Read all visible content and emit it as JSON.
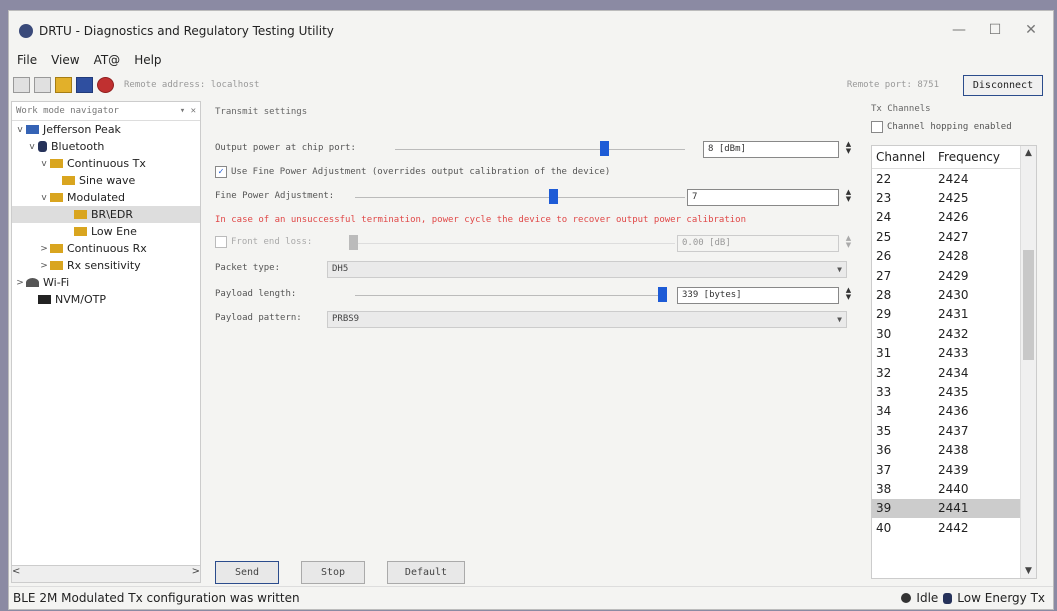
{
  "window": {
    "title": "DRTU - Diagnostics and Regulatory Testing Utility",
    "minimize": "—",
    "maximize": "☐",
    "close": "✕"
  },
  "menu": [
    "File",
    "View",
    "AT@",
    "Help"
  ],
  "toolbar": {
    "remote_address": "Remote address: localhost",
    "remote_port": "Remote port: 8751",
    "disconnect": "Disconnect"
  },
  "nav": {
    "header": "Work mode navigator",
    "pin": "▾ ✕",
    "items": [
      {
        "label": "Jefferson Peak",
        "chev": "v",
        "icon": "person",
        "indent": 0
      },
      {
        "label": "Bluetooth",
        "chev": "v",
        "icon": "bt",
        "indent": 1
      },
      {
        "label": "Continuous Tx",
        "chev": "v",
        "icon": "folder",
        "indent": 2
      },
      {
        "label": "Sine wave",
        "chev": "",
        "icon": "folder",
        "indent": 3
      },
      {
        "label": "Modulated",
        "chev": "v",
        "icon": "folder",
        "indent": 2
      },
      {
        "label": "BR\\EDR",
        "chev": "",
        "icon": "folder",
        "indent": 4,
        "selected": true
      },
      {
        "label": "Low Ene",
        "chev": "",
        "icon": "folder",
        "indent": 4
      },
      {
        "label": "Continuous Rx",
        "chev": ">",
        "icon": "folder",
        "indent": 2
      },
      {
        "label": "Rx sensitivity",
        "chev": ">",
        "icon": "folder",
        "indent": 2
      },
      {
        "label": "Wi-Fi",
        "chev": ">",
        "icon": "wifi",
        "indent": 0
      },
      {
        "label": "NVM/OTP",
        "chev": "",
        "icon": "nvm",
        "indent": 1
      }
    ],
    "scroll_left": "<",
    "scroll_right": ">"
  },
  "settings": {
    "group_title": "Transmit settings",
    "output_power_label": "Output power at chip port:",
    "output_power_value": "8 [dBm]",
    "fine_power_checkbox": "Use Fine Power Adjustment (overrides output calibration of the device)",
    "fine_power_checked": true,
    "fine_power_label": "Fine Power Adjustment:",
    "fine_power_value": "7",
    "warning": "In case of an unsuccessful termination, power cycle the device to recover output power calibration",
    "front_end_loss_label": "Front end loss:",
    "front_end_loss_value": "0.00 [dB]",
    "packet_type_label": "Packet type:",
    "packet_type_value": "DH5",
    "payload_length_label": "Payload length:",
    "payload_length_value": "339 [bytes]",
    "payload_pattern_label": "Payload pattern:",
    "payload_pattern_value": "PRBS9",
    "slider_output_power_level": 0.72,
    "slider_fine_power_level": 0.6,
    "slider_payload_length_level": 0.99
  },
  "buttons": {
    "send": "Send",
    "stop": "Stop",
    "default": "Default"
  },
  "channels": {
    "title": "Tx Channels",
    "hopping_label": "Channel hopping enabled",
    "hopping_checked": false,
    "col_channel": "Channel",
    "col_frequency": "Frequency",
    "rows": [
      [
        "22",
        "2424"
      ],
      [
        "23",
        "2425"
      ],
      [
        "24",
        "2426"
      ],
      [
        "25",
        "2427"
      ],
      [
        "26",
        "2428"
      ],
      [
        "27",
        "2429"
      ],
      [
        "28",
        "2430"
      ],
      [
        "29",
        "2431"
      ],
      [
        "30",
        "2432"
      ],
      [
        "31",
        "2433"
      ],
      [
        "32",
        "2434"
      ],
      [
        "33",
        "2435"
      ],
      [
        "34",
        "2436"
      ],
      [
        "35",
        "2437"
      ],
      [
        "36",
        "2438"
      ],
      [
        "37",
        "2439"
      ],
      [
        "38",
        "2440"
      ],
      [
        "39",
        "2441"
      ],
      [
        "40",
        "2442"
      ]
    ],
    "selected_channel": "39"
  },
  "status": {
    "message": "BLE 2M Modulated Tx configuration was written",
    "state": "Idle",
    "mode": "Low Energy Tx"
  }
}
